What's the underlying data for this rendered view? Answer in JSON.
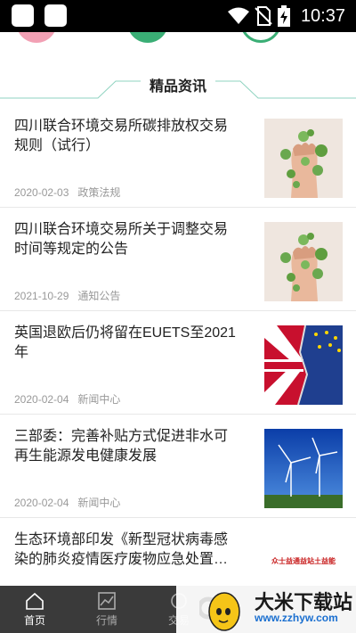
{
  "status_bar": {
    "time": "10:37",
    "icons": [
      "wifi-icon",
      "no-sim-icon",
      "battery-charging-icon"
    ]
  },
  "section": {
    "title": "精品资讯"
  },
  "news": [
    {
      "title": "四川联合环境交易所碳排放权交易规则（试行）",
      "date": "2020-02-03",
      "category": "政策法规",
      "image": "fist-plant-image"
    },
    {
      "title": "四川联合环境交易所关于调整交易时间等规定的公告",
      "date": "2021-10-29",
      "category": "通知公告",
      "image": "fist-plant-image"
    },
    {
      "title": "英国退欧后仍将留在EUETS至2021年",
      "date": "2020-02-04",
      "category": "新闻中心",
      "image": "uk-eu-flag-image"
    },
    {
      "title": "三部委：完善补贴方式促进非水可再生能源发电健康发展",
      "date": "2020-02-04",
      "category": "新闻中心",
      "image": "wind-turbine-image"
    },
    {
      "title": "生态环境部印发《新型冠状病毒感染的肺炎疫情医疗废物应急处置…",
      "date": "",
      "category": "",
      "image": "red-text-image"
    }
  ],
  "bottom_nav": {
    "items": [
      {
        "label": "首页",
        "icon": "home-icon",
        "active": true
      },
      {
        "label": "行情",
        "icon": "chart-icon",
        "active": false
      },
      {
        "label": "交易",
        "icon": "trade-icon",
        "active": false
      }
    ]
  },
  "watermark": {
    "title": "大米下载站",
    "url": "www.zzhyw.com",
    "badge_text": "众士益通益站土益能"
  },
  "colors": {
    "accent": "#3aae75",
    "nav_bg": "#3a3a3a",
    "meta_text": "#999999"
  }
}
